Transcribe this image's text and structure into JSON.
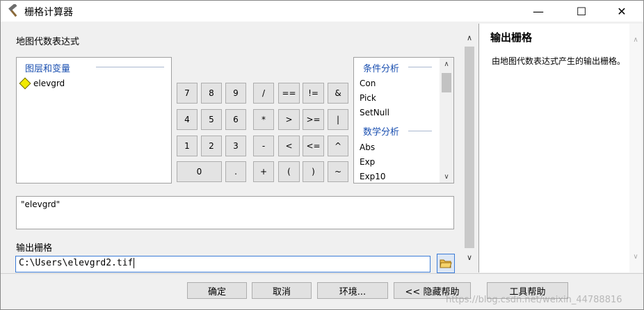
{
  "window": {
    "title": "栅格计算器",
    "app_icon": "hammer-icon",
    "controls": {
      "minimize": "—",
      "maximize": "☐",
      "close": "✕"
    }
  },
  "main": {
    "expression_section_label": "地图代数表达式",
    "layers": {
      "group_title": "图层和变量",
      "items": [
        {
          "name": "elevgrd",
          "icon": "raster-layer-diamond-icon"
        }
      ]
    },
    "keypad": {
      "keys": [
        "7",
        "8",
        "9",
        "/",
        "==",
        "!=",
        "&",
        "4",
        "5",
        "6",
        "*",
        ">",
        ">=",
        "|",
        "1",
        "2",
        "3",
        "-",
        "<",
        "<=",
        "^",
        "0",
        ".",
        "+",
        "(",
        ")",
        "~"
      ]
    },
    "functions": {
      "groups": [
        {
          "title": "条件分析",
          "items": [
            "Con",
            "Pick",
            "SetNull"
          ]
        },
        {
          "title": "数学分析",
          "items": [
            "Abs",
            "Exp",
            "Exp10"
          ]
        }
      ]
    },
    "expression_value": "\"elevgrd\"",
    "output_label": "输出栅格",
    "output_value": "C:\\Users\\elevgrd2.tif"
  },
  "help": {
    "title": "输出栅格",
    "body": "由地图代数表达式产生的输出栅格。"
  },
  "buttons": {
    "ok": "确定",
    "cancel": "取消",
    "environments": "环境...",
    "hide_help": "<< 隐藏帮助",
    "tool_help": "工具帮助"
  },
  "watermark": "https://blog.csdn.net/weixin_44788816"
}
